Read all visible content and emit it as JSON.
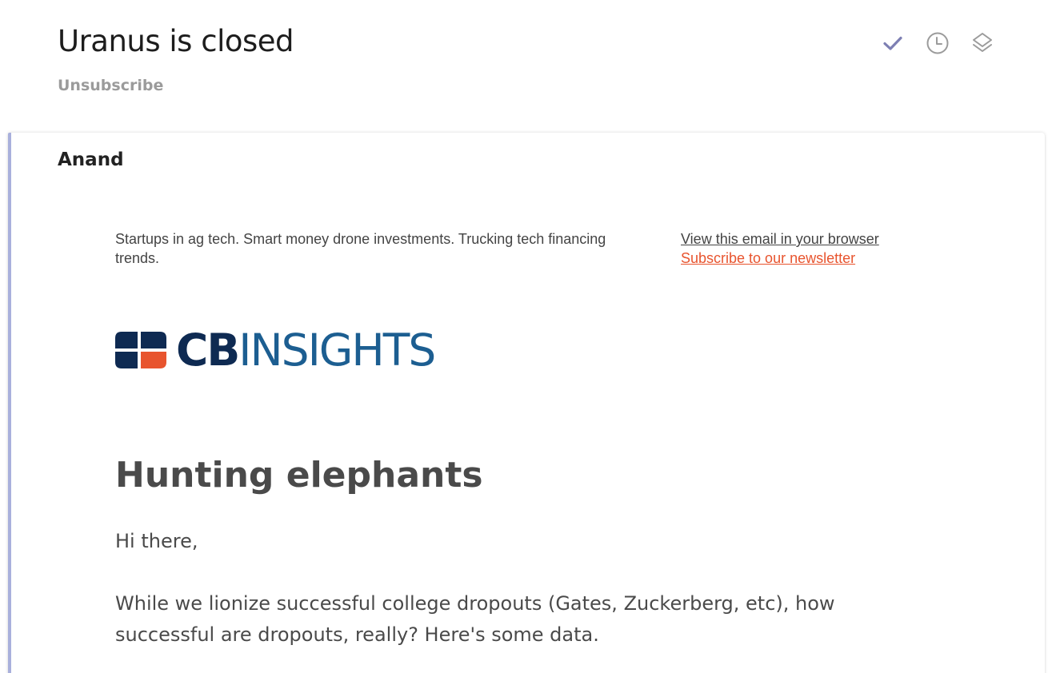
{
  "header": {
    "subject": "Uranus is closed",
    "unsubscribe_label": "Unsubscribe",
    "actions": [
      {
        "icon": "check-icon",
        "color": "#7d7fb3"
      },
      {
        "icon": "clock-icon",
        "color": "#9b9b9b"
      },
      {
        "icon": "layers-icon",
        "color": "#9b9b9b"
      }
    ]
  },
  "message": {
    "sender": "Anand",
    "accent_color": "#a9b0dc",
    "preheader": "Startups in ag tech. Smart money drone investments. Trucking tech financing trends.",
    "view_in_browser": "View this email in your browser",
    "subscribe_link": "Subscribe to our newsletter",
    "subscribe_color": "#e8542e",
    "logo": {
      "cb": "CB",
      "insights": "INSIGHTS",
      "colors": {
        "navy": "#0e2a52",
        "blue": "#1c5e91",
        "orange": "#e8542e"
      }
    },
    "headline": "Hunting elephants",
    "greeting": "Hi there,",
    "paragraph": "While we lionize successful college dropouts (Gates, Zuckerberg, etc), how successful are dropouts, really? Here's some data."
  }
}
